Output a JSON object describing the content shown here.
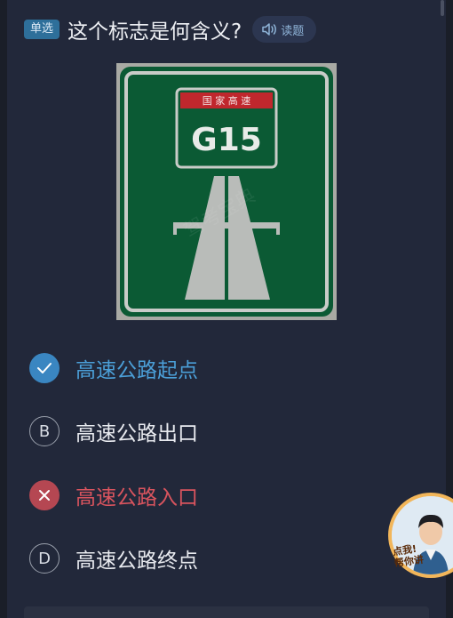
{
  "question": {
    "type_badge": "单选",
    "text": "这个标志是何含义?",
    "read_button": "读题"
  },
  "sign": {
    "header": "国 家 高 速",
    "route": "G15",
    "watermark": "驾考宝典",
    "colors": {
      "green": "#0b5a34",
      "red": "#c0272d",
      "road": "#b9bcb9"
    }
  },
  "options": [
    {
      "marker": "",
      "text": "高速公路起点",
      "state": "correct"
    },
    {
      "marker": "B",
      "text": "高速公路出口",
      "state": "normal"
    },
    {
      "marker": "",
      "text": "高速公路入口",
      "state": "wrong"
    },
    {
      "marker": "D",
      "text": "高速公路终点",
      "state": "normal"
    }
  ],
  "tutor": {
    "label_line1": "点我!",
    "label_line2": "帮你讲"
  },
  "colors": {
    "accent": "#3a86c1",
    "wrong": "#b54752",
    "background": "#22283a"
  }
}
